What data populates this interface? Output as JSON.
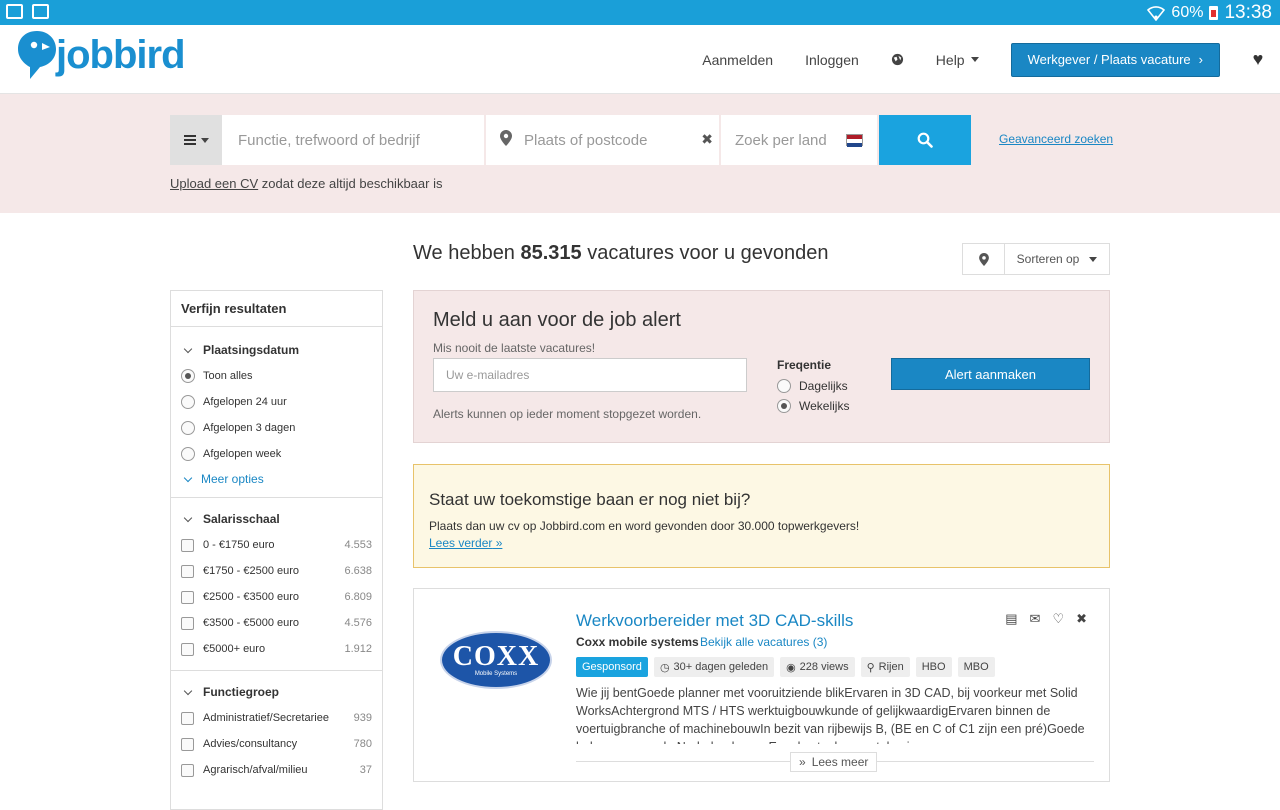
{
  "statusbar": {
    "battery": "60%",
    "time": "13:38"
  },
  "header": {
    "logo": "jobbird",
    "nav": {
      "register": "Aanmelden",
      "login": "Inloggen",
      "help": "Help",
      "employer_button": "Werkgever / Plaats vacature"
    }
  },
  "search": {
    "keyword_placeholder": "Functie, trefwoord of bedrijf",
    "location_placeholder": "Plaats of postcode",
    "country_placeholder": "Zoek per land",
    "advanced_link": "Geavanceerd zoeken",
    "upload_link": "Upload een CV",
    "upload_text": "zodat deze altijd beschikbaar is"
  },
  "results": {
    "prefix": "We hebben",
    "count": "85.315",
    "suffix": "vacatures voor u gevonden",
    "sort_label": "Sorteren op"
  },
  "sidebar": {
    "title": "Verfijn resultaten",
    "date_section": {
      "title": "Plaatsingsdatum",
      "options": [
        "Toon alles",
        "Afgelopen 24 uur",
        "Afgelopen 3 dagen",
        "Afgelopen week"
      ],
      "more": "Meer opties"
    },
    "salary_section": {
      "title": "Salarisschaal",
      "options": [
        {
          "label": "0 - €1750 euro",
          "count": "4.553"
        },
        {
          "label": "€1750 - €2500 euro",
          "count": "6.638"
        },
        {
          "label": "€2500 - €3500 euro",
          "count": "6.809"
        },
        {
          "label": "€3500 - €5000 euro",
          "count": "4.576"
        },
        {
          "label": "€5000+ euro",
          "count": "1.912"
        }
      ]
    },
    "group_section": {
      "title": "Functiegroep",
      "options": [
        {
          "label": "Administratief/Secretariee",
          "count": "939"
        },
        {
          "label": "Advies/consultancy",
          "count": "780"
        },
        {
          "label": "Agrarisch/afval/milieu",
          "count": "37"
        }
      ]
    }
  },
  "alert": {
    "title": "Meld u aan voor de job alert",
    "subtitle": "Mis nooit de laatste vacatures!",
    "email_placeholder": "Uw e-mailadres",
    "note": "Alerts kunnen op ieder moment stopgezet worden.",
    "freq_title": "Freqentie",
    "freq_daily": "Dagelijks",
    "freq_weekly": "Wekelijks",
    "button": "Alert aanmaken"
  },
  "promo": {
    "title": "Staat uw toekomstige baan er nog niet bij?",
    "text": "Plaats dan uw cv op Jobbird.com en word gevonden door 30.000 topwerkgevers!",
    "link": "Lees verder"
  },
  "job": {
    "logo_text": "COXX",
    "logo_sub": "Mobile Systems",
    "title": "Werkvoorbereider met 3D CAD-skills",
    "company": "Coxx mobile systems",
    "all_link": "Bekijk alle vacatures (3)",
    "sponsored": "Gesponsord",
    "posted": "30+ dagen geleden",
    "views": "228 views",
    "location": "Rijen",
    "level1": "HBO",
    "level2": "MBO",
    "description": "Wie jij bentGoede planner met vooruitziende blikErvaren in 3D CAD, bij voorkeur met Solid WorksAchtergrond MTS / HTS werktuigbouwkunde of gelijkwaardigErvaren binnen de voertuigbranche of machinebouwIn bezit van rijbewijs B, (BE en C of C1 zijn een pré)Goede beheerser van de Nederlandse en Engelse taal, meer talen is een",
    "read_more": "Lees meer"
  }
}
